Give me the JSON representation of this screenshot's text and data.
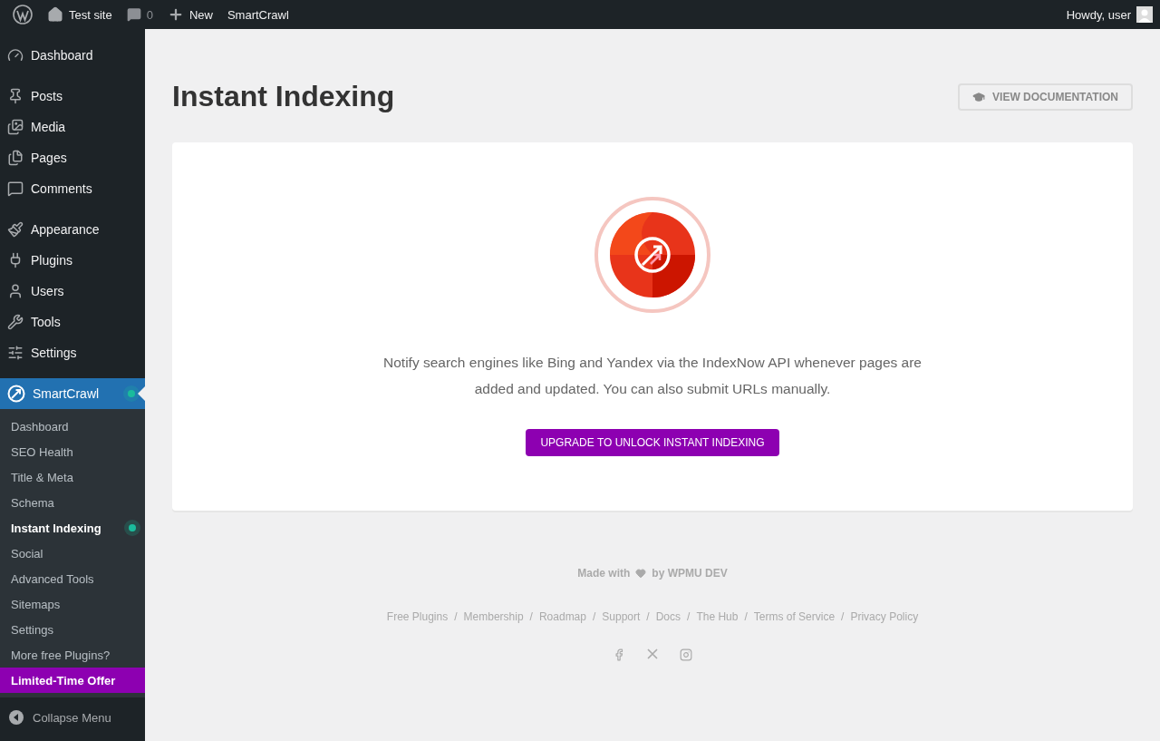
{
  "admin_bar": {
    "site": "Test site",
    "comments": "0",
    "new": "New",
    "plugin": "SmartCrawl",
    "greeting": "Howdy, user"
  },
  "sidebar": {
    "groups": [
      [
        {
          "label": "Dashboard"
        }
      ],
      [
        {
          "label": "Posts"
        },
        {
          "label": "Media"
        },
        {
          "label": "Pages"
        },
        {
          "label": "Comments"
        }
      ],
      [
        {
          "label": "Appearance"
        },
        {
          "label": "Plugins"
        },
        {
          "label": "Users"
        },
        {
          "label": "Tools"
        },
        {
          "label": "Settings"
        }
      ]
    ],
    "plugin": {
      "label": "SmartCrawl",
      "selected": true,
      "dot": true
    },
    "submenu": [
      {
        "label": "Dashboard",
        "kind": "link",
        "selected": false,
        "dot": false
      },
      {
        "label": "SEO Health",
        "kind": "link",
        "selected": false,
        "dot": false
      },
      {
        "label": "Title & Meta",
        "kind": "link",
        "selected": false,
        "dot": false
      },
      {
        "label": "Schema",
        "kind": "link",
        "selected": false,
        "dot": false
      },
      {
        "label": "Instant Indexing",
        "kind": "link",
        "selected": true,
        "dot": true
      },
      {
        "label": "Social",
        "kind": "link",
        "selected": false,
        "dot": false
      },
      {
        "label": "Advanced Tools",
        "kind": "link",
        "selected": false,
        "dot": false
      },
      {
        "label": "Sitemaps",
        "kind": "link",
        "selected": false,
        "dot": false
      },
      {
        "label": "Settings",
        "kind": "link",
        "selected": false,
        "dot": false
      },
      {
        "label": "More free Plugins?",
        "kind": "link",
        "selected": false,
        "dot": false
      },
      {
        "label": "Limited-Time Offer",
        "kind": "promo",
        "selected": false,
        "dot": false
      }
    ],
    "collapse": "Collapse Menu"
  },
  "page": {
    "title": "Instant Indexing",
    "doc_button": "VIEW DOCUMENTATION"
  },
  "card": {
    "description": "Notify search engines like Bing and Yandex via the IndexNow API whenever pages are added and updated. You can also submit URLs manually.",
    "upgrade_button": "UPGRADE TO UNLOCK INSTANT INDEXING"
  },
  "footer": {
    "made_with": "Made with",
    "by": "by WPMU DEV",
    "links": [
      "Free Plugins",
      "Membership",
      "Roadmap",
      "Support",
      "Docs",
      "The Hub",
      "Terms of Service",
      "Privacy Policy"
    ],
    "separator": "/"
  }
}
